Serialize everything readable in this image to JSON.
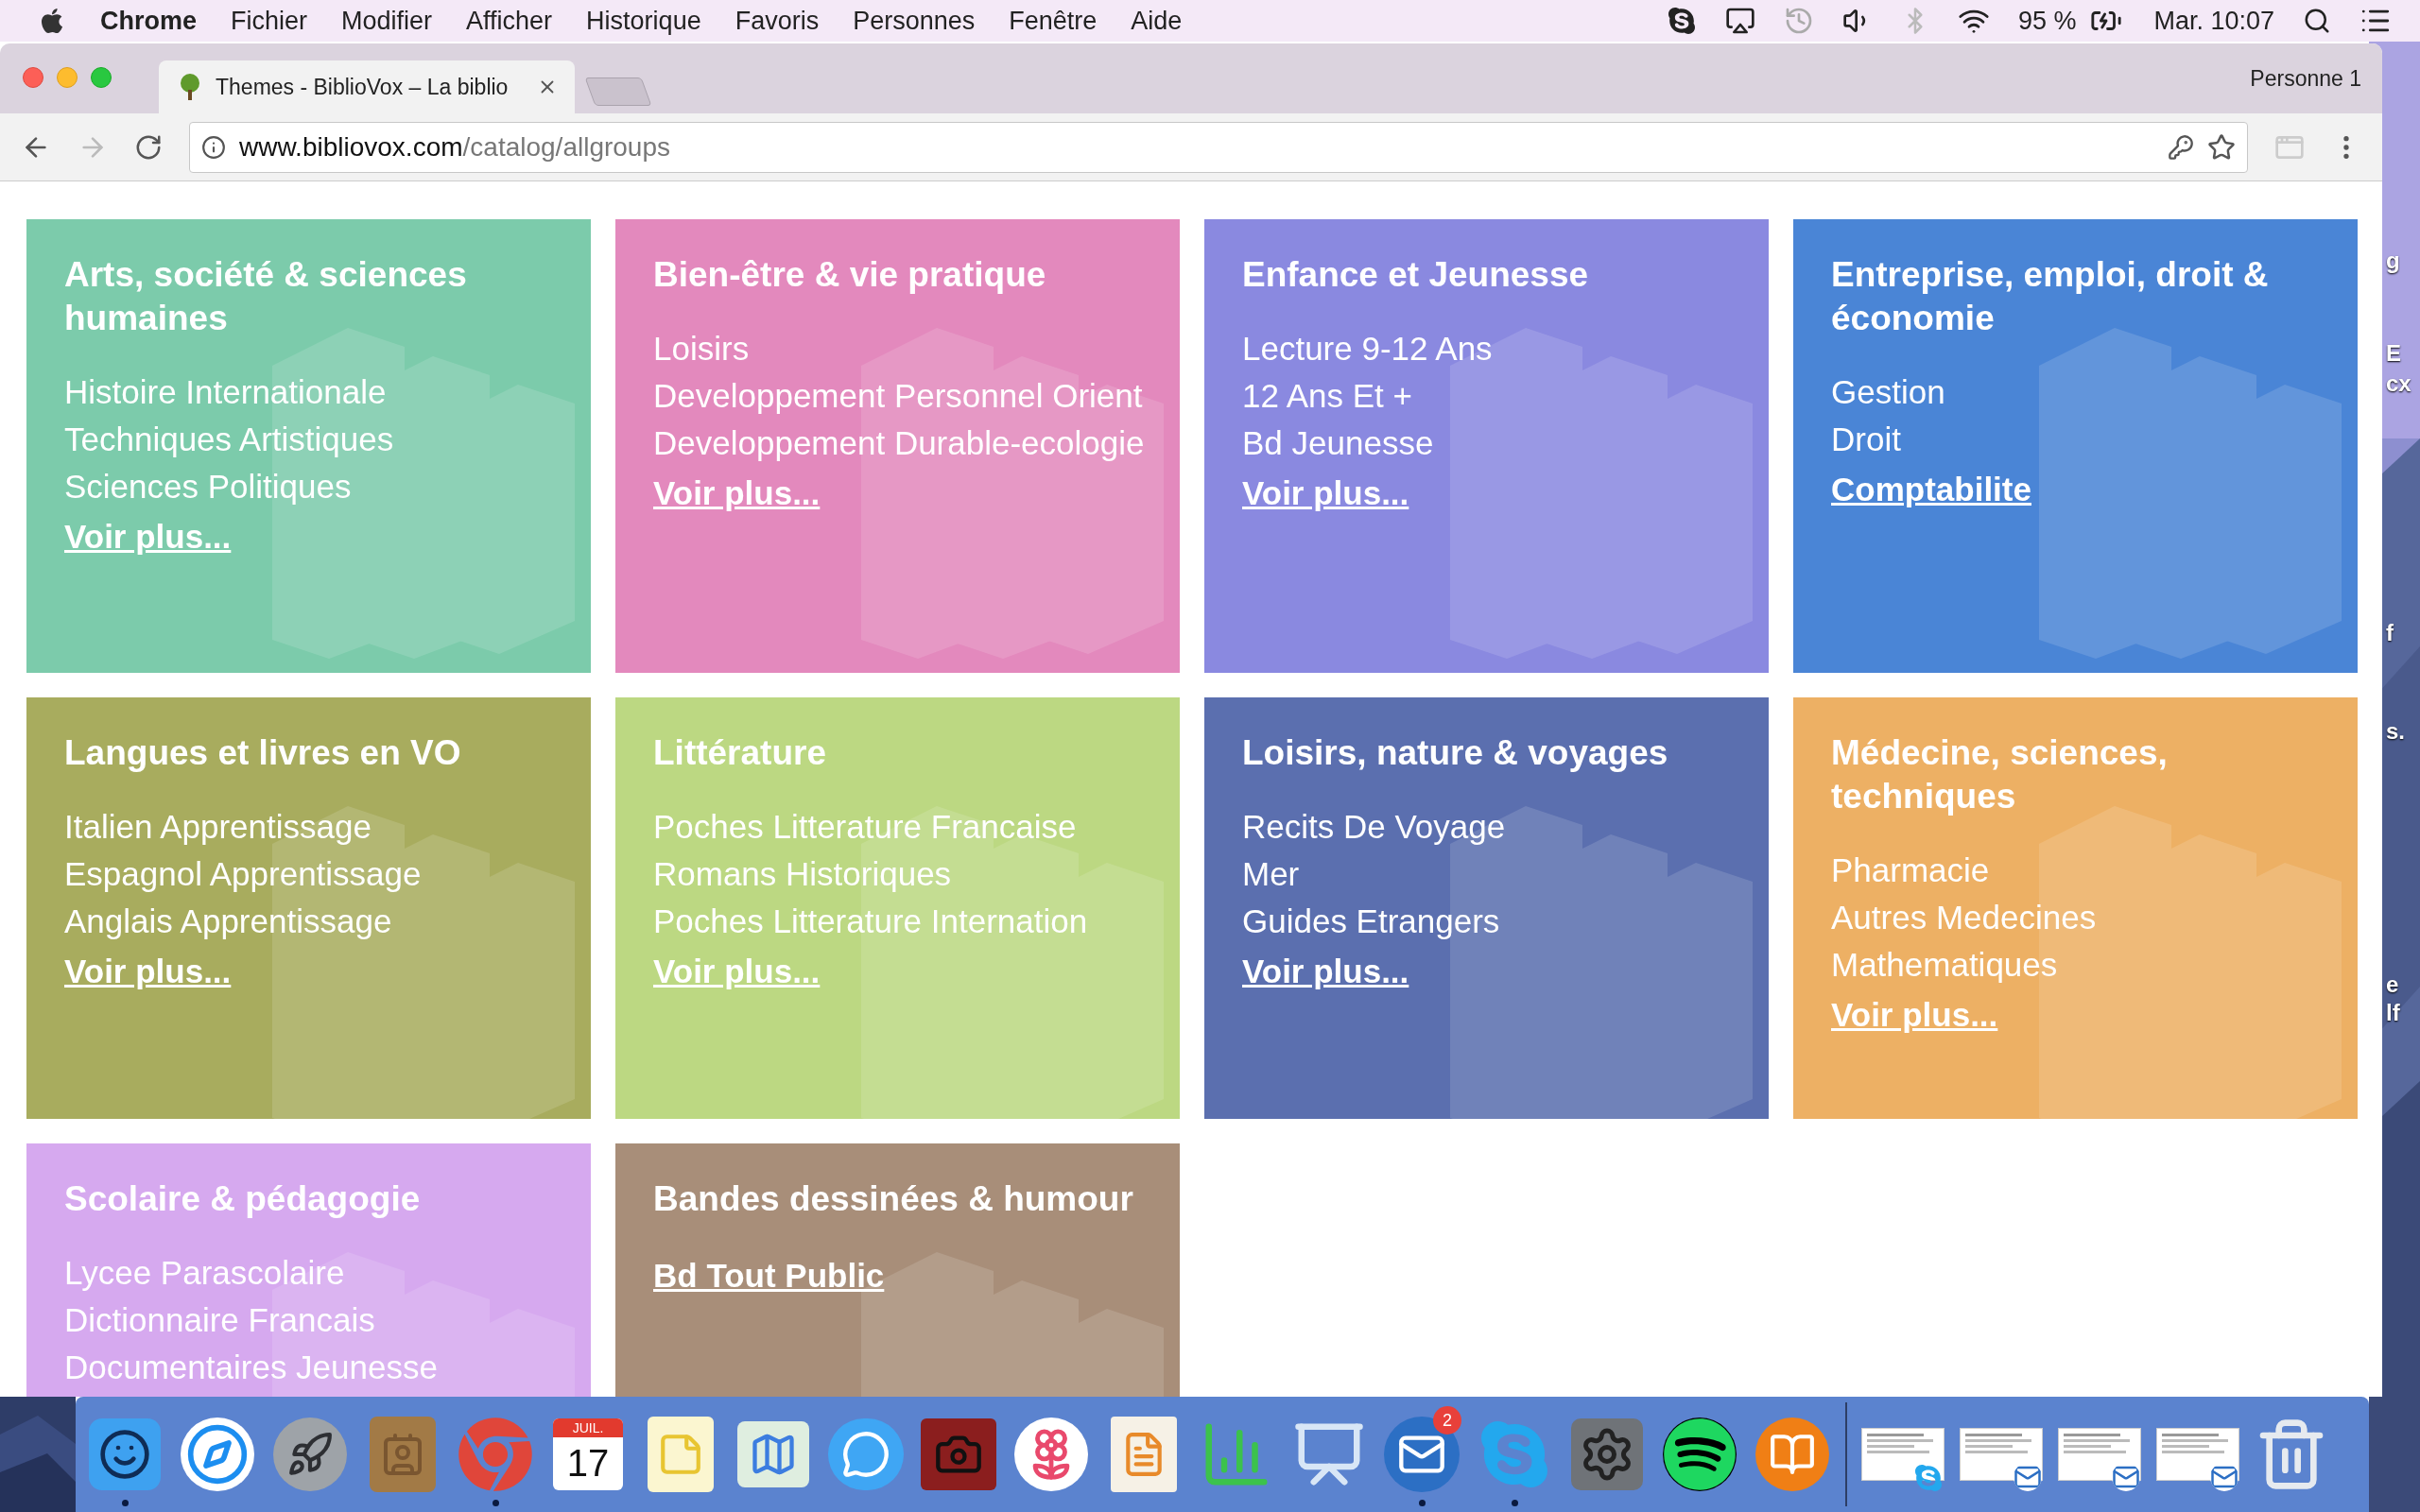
{
  "menu_bar": {
    "app": "Chrome",
    "menus": [
      "Fichier",
      "Modifier",
      "Afficher",
      "Historique",
      "Favoris",
      "Personnes",
      "Fenêtre",
      "Aide"
    ],
    "battery": "95 %",
    "clock": "Mar. 10:07"
  },
  "browser": {
    "tab": {
      "title": "Themes - BiblioVox – La biblio",
      "selected": true
    },
    "profile": "Personne 1",
    "url_host": "www.bibliovox.com",
    "url_path": "/catalog/allgroups"
  },
  "categories": [
    {
      "title": "Arts, société & sciences humaines",
      "color": "#7ccbab",
      "items": [
        {
          "kind": "text",
          "label": "Histoire Internationale"
        },
        {
          "kind": "text",
          "label": "Techniques Artistiques"
        },
        {
          "kind": "text",
          "label": "Sciences Politiques"
        },
        {
          "kind": "link",
          "label": "Voir plus..."
        }
      ]
    },
    {
      "title": "Bien-être & vie pratique",
      "color": "#e389bd",
      "items": [
        {
          "kind": "text",
          "label": "Loisirs"
        },
        {
          "kind": "text",
          "label": "Developpement Personnel Orient"
        },
        {
          "kind": "text",
          "label": "Developpement Durable-ecologie"
        },
        {
          "kind": "link",
          "label": "Voir plus..."
        }
      ]
    },
    {
      "title": "Enfance et Jeunesse",
      "color": "#8a89e0",
      "items": [
        {
          "kind": "text",
          "label": "Lecture 9-12 Ans"
        },
        {
          "kind": "text",
          "label": "12 Ans Et +"
        },
        {
          "kind": "text",
          "label": "Bd Jeunesse"
        },
        {
          "kind": "link",
          "label": "Voir plus..."
        }
      ]
    },
    {
      "title": "Entreprise, emploi, droit & économie",
      "color": "#4a85d6",
      "items": [
        {
          "kind": "text",
          "label": "Gestion"
        },
        {
          "kind": "text",
          "label": "Droit"
        },
        {
          "kind": "link",
          "label": "Comptabilite"
        }
      ]
    },
    {
      "title": "Langues et livres en VO",
      "color": "#a8ac5e",
      "items": [
        {
          "kind": "text",
          "label": "Italien Apprentissage"
        },
        {
          "kind": "text",
          "label": "Espagnol Apprentissage"
        },
        {
          "kind": "text",
          "label": "Anglais Apprentissage"
        },
        {
          "kind": "link",
          "label": "Voir plus..."
        }
      ]
    },
    {
      "title": "Littérature",
      "color": "#bcd882",
      "items": [
        {
          "kind": "text",
          "label": "Poches Litterature Francaise"
        },
        {
          "kind": "text",
          "label": "Romans Historiques"
        },
        {
          "kind": "text",
          "label": "Poches Litterature Internation"
        },
        {
          "kind": "link",
          "label": "Voir plus..."
        }
      ]
    },
    {
      "title": "Loisirs, nature & voyages",
      "color": "#5b6faf",
      "items": [
        {
          "kind": "text",
          "label": "Recits De Voyage"
        },
        {
          "kind": "text",
          "label": "Mer"
        },
        {
          "kind": "text",
          "label": "Guides Etrangers"
        },
        {
          "kind": "link",
          "label": "Voir plus..."
        }
      ]
    },
    {
      "title": "Médecine, sciences, techniques",
      "color": "#edb064",
      "items": [
        {
          "kind": "text",
          "label": "Pharmacie"
        },
        {
          "kind": "text",
          "label": "Autres Medecines"
        },
        {
          "kind": "text",
          "label": "Mathematiques"
        },
        {
          "kind": "link",
          "label": "Voir plus..."
        }
      ]
    },
    {
      "title": "Scolaire & pédagogie",
      "color": "#d6a9ef",
      "items": [
        {
          "kind": "text",
          "label": "Lycee Parascolaire"
        },
        {
          "kind": "text",
          "label": "Dictionnaire Francais"
        },
        {
          "kind": "text",
          "label": "Documentaires Jeunesse"
        }
      ]
    },
    {
      "title": "Bandes dessinées & humour",
      "color": "#a88e79",
      "items": [
        {
          "kind": "link",
          "label": "Bd Tout Public"
        }
      ]
    }
  ],
  "dock": {
    "apps": [
      {
        "running": true
      },
      {
        "running": false
      },
      {
        "running": false
      },
      {
        "running": false
      },
      {
        "running": true
      },
      {
        "running": false,
        "month": "JUIL.",
        "day": "17"
      },
      {
        "running": false
      },
      {
        "running": false
      },
      {
        "running": false
      },
      {
        "running": false
      },
      {
        "running": false
      },
      {
        "running": false
      },
      {
        "running": false
      },
      {
        "running": false
      },
      {
        "running": true,
        "badge": "2"
      },
      {
        "running": true
      },
      {
        "running": false
      },
      {
        "running": false
      },
      {
        "running": false
      }
    ],
    "windows": [
      {
        "kind": "window"
      },
      {
        "kind": "window"
      },
      {
        "kind": "window"
      },
      {
        "kind": "window"
      }
    ]
  },
  "desktop_labels": [
    "g",
    "E",
    "cx",
    "f",
    "s.",
    "e",
    "lf"
  ]
}
